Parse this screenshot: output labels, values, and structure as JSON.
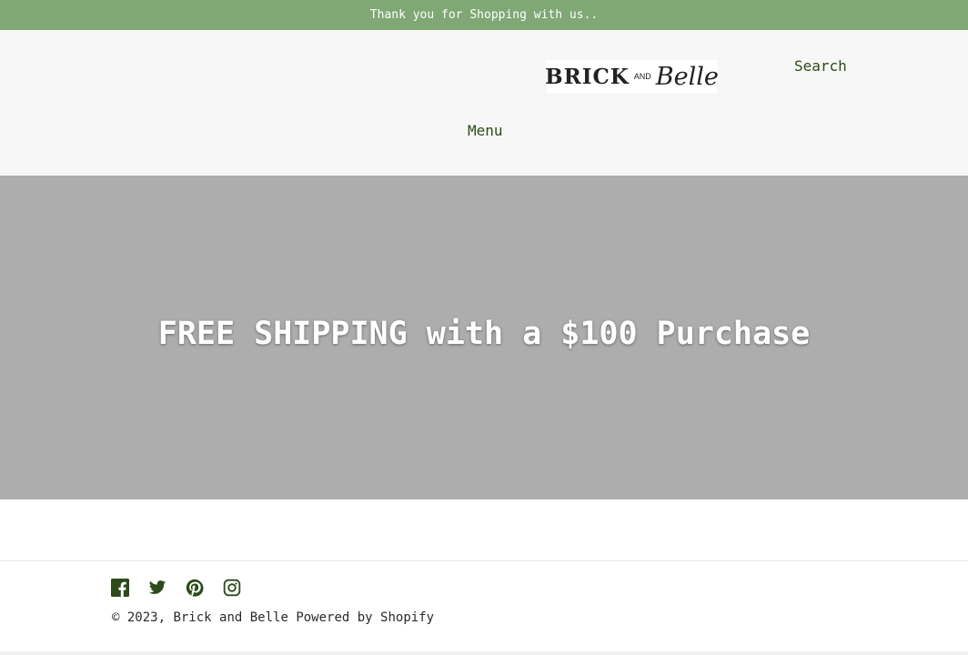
{
  "announcement": {
    "text": "Thank you for Shopping with us.."
  },
  "header": {
    "logo": {
      "word1": "BRICK",
      "word2": "AND",
      "word3": "Belle"
    },
    "search_label": "Search",
    "menu_label": "Menu"
  },
  "hero": {
    "headline": "FREE SHIPPING with a $100 Purchase"
  },
  "footer": {
    "social_icons": [
      "facebook-icon",
      "twitter-icon",
      "pinterest-icon",
      "instagram-icon"
    ],
    "copyright_prefix": "© 2023, ",
    "store_name": "Brick and Belle",
    "powered_by": "Powered by Shopify"
  },
  "colors": {
    "announcement_bg": "#7fa874",
    "header_bg": "#f7f7f7",
    "hero_bg": "#adadad",
    "link_color": "#2d4a1a"
  }
}
